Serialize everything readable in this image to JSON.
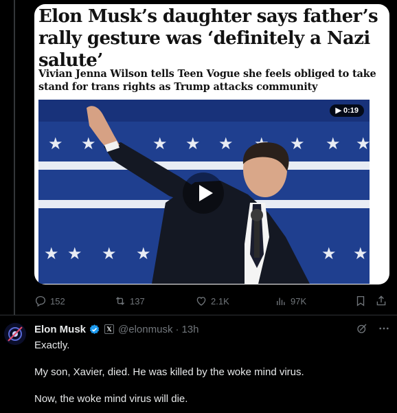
{
  "quoted_post": {
    "headline": "Elon Musk’s daughter says father’s rally gesture was ‘definitely a Nazi salute’",
    "standfirst": "Vivian Jenna Wilson tells Teen Vogue she feels obliged to take stand for trans rights as Trump attacks community",
    "video_duration": "0:19",
    "stats": {
      "replies": "152",
      "reposts": "137",
      "likes": "2.1K",
      "views": "97K"
    }
  },
  "reply": {
    "author_name": "Elon Musk",
    "handle": "@elonmusk",
    "separator": "·",
    "time": "13h",
    "x_badge": "𝕏",
    "lines": [
      "Exactly.",
      "My son, Xavier, died. He was killed by the woke mind virus.",
      "Now, the woke mind virus will die."
    ]
  },
  "colors": {
    "background": "#000000",
    "muted_text": "#71767b",
    "verified_blue": "#1d9bf0",
    "flag_blue": "#1f3f8f"
  }
}
